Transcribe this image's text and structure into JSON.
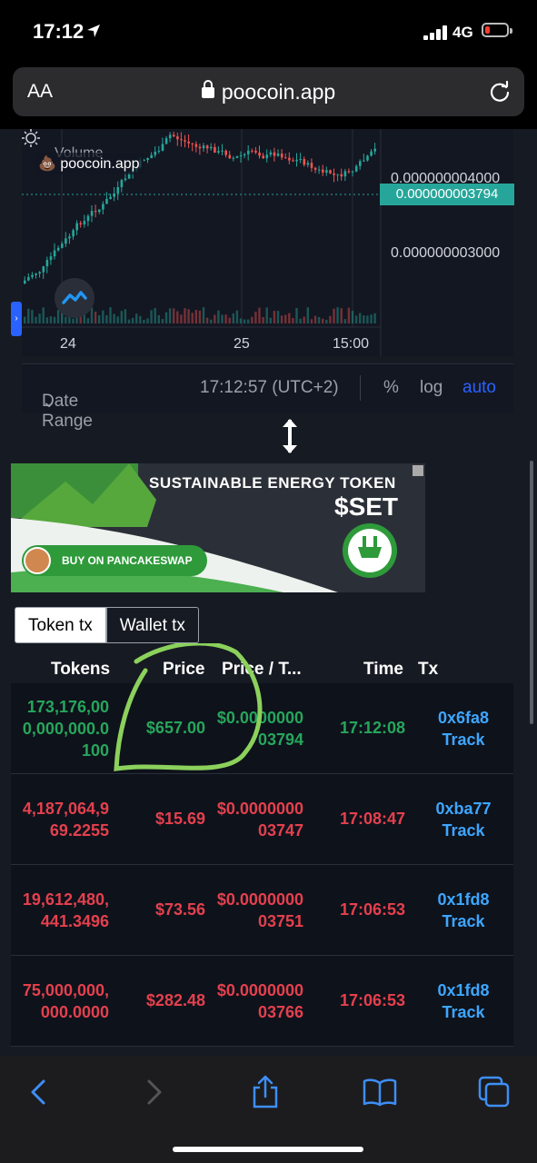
{
  "status_bar": {
    "time": "17:12",
    "network": "4G"
  },
  "browser": {
    "text_size_label": "AA",
    "url": "poocoin.app"
  },
  "chart": {
    "watermark": "poocoin.app",
    "volume_label": "Volume",
    "last_price": "0.000000003794",
    "y_ticks": [
      "0.000000004000",
      "0.000000003000"
    ],
    "x_ticks": [
      "24",
      "25",
      "15:00"
    ],
    "up_color": "#26a69a",
    "down_color": "#ef5350"
  },
  "range_bar": {
    "date_range_label": "Date Range",
    "clock": "17:12:57 (UTC+2)",
    "percent": "%",
    "log": "log",
    "auto": "auto"
  },
  "banner": {
    "headline": "SUSTAINABLE ENERGY TOKEN",
    "ticker": "$SET",
    "cta": "BUY ON PANCAKESWAP"
  },
  "tabs": {
    "token_tx": "Token tx",
    "wallet_tx": "Wallet tx"
  },
  "table": {
    "headers": {
      "tokens": "Tokens",
      "price": "Price",
      "price_per_token": "Price / T...",
      "time": "Time",
      "tx": "Tx"
    },
    "rows": [
      {
        "side": "buy",
        "tokens": "173,176,000,000,000.0100",
        "price": "$657.00",
        "price_per_token": "$0.000000003794",
        "time": "17:12:08",
        "tx": "0x6fa8",
        "track": "Track"
      },
      {
        "side": "sell",
        "tokens": "4,187,064,969.2255",
        "price": "$15.69",
        "price_per_token": "$0.000000003747",
        "time": "17:08:47",
        "tx": "0xba77",
        "track": "Track"
      },
      {
        "side": "sell",
        "tokens": "19,612,480,441.3496",
        "price": "$73.56",
        "price_per_token": "$0.000000003751",
        "time": "17:06:53",
        "tx": "0x1fd8",
        "track": "Track"
      },
      {
        "side": "sell",
        "tokens": "75,000,000,000.0000",
        "price": "$282.48",
        "price_per_token": "$0.000000003766",
        "time": "17:06:53",
        "tx": "0x1fd8",
        "track": "Track"
      }
    ]
  },
  "toolbar_icons": [
    "back-icon",
    "forward-icon",
    "share-icon",
    "bookmarks-icon",
    "tabs-icon"
  ]
}
